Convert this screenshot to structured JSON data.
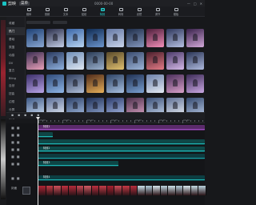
{
  "app": {
    "name": "剪映",
    "menu_label": "菜单",
    "title": "0000-00-00",
    "window_controls": [
      "—",
      "□",
      "✕"
    ]
  },
  "toolbar": {
    "items": [
      {
        "label": "媒体",
        "icon": "media-icon"
      },
      {
        "label": "音频",
        "icon": "audio-icon"
      },
      {
        "label": "文本",
        "icon": "text-icon"
      },
      {
        "label": "贴纸",
        "icon": "sticker-icon"
      },
      {
        "label": "特效",
        "icon": "effects-icon",
        "active": true
      },
      {
        "label": "转场",
        "icon": "transition-icon"
      },
      {
        "label": "滤镜",
        "icon": "filter-icon"
      },
      {
        "label": "调节",
        "icon": "adjust-icon"
      },
      {
        "label": "模板",
        "icon": "template-icon"
      }
    ]
  },
  "categories": {
    "items": [
      "收藏",
      "热门",
      "基础",
      "氛围",
      "动感",
      "DV",
      "复古",
      "Bling",
      "自然",
      "扭曲",
      "边框",
      "分屏",
      "纹理",
      "漫画",
      "金粉",
      "光"
    ],
    "active_index": 1
  },
  "thumbs": {
    "colors": [
      [
        "#1c3f73",
        "#8aa7d2"
      ],
      [
        "#2a2e4a",
        "#c3cde6"
      ],
      [
        "#3a66a8",
        "#b8d4f1"
      ],
      [
        "#0f2b53",
        "#6c95cc"
      ],
      [
        "#6478a4",
        "#c9d4ea"
      ],
      [
        "#1e2d49",
        "#8497bd"
      ],
      [
        "#4c1d3a",
        "#f28fb8"
      ],
      [
        "#2e375c",
        "#b5c0e2"
      ],
      [
        "#38214a",
        "#d2a8d9"
      ],
      [
        "#3b2e52",
        "#e8a0b8"
      ],
      [
        "#2a3a5f",
        "#8fb1de"
      ],
      [
        "#6f8fb8",
        "#e0e8f2"
      ],
      [
        "#2a3b55",
        "#9ab0cc"
      ],
      [
        "#5a4a2a",
        "#e0c070"
      ],
      [
        "#3a4b6f",
        "#9cb4d7"
      ],
      [
        "#4a1f2c",
        "#e27b86"
      ],
      [
        "#4c3b6a",
        "#d3b8e6"
      ],
      [
        "#2a3556",
        "#aeb9dd"
      ],
      [
        "#3a2e68",
        "#b8a4e6"
      ],
      [
        "#2f4a78",
        "#8fb6e6"
      ],
      [
        "#2e3c5c",
        "#b0bfd9"
      ],
      [
        "#4e2a1a",
        "#e6b05a"
      ],
      [
        "#2c4264",
        "#a8c0e0"
      ],
      [
        "#1f3052",
        "#7aa0d0"
      ],
      [
        "#6a7fa8",
        "#e4eaf3"
      ],
      [
        "#4a2e5a",
        "#d8a0c8"
      ],
      [
        "#3b2a55",
        "#c9a7e2"
      ],
      [
        "#3c5784",
        "#c7d8ef"
      ],
      [
        "#5a6d96",
        "#dfe6f2"
      ],
      [
        "#2b3f66",
        "#9fb7dc"
      ],
      [
        "#1e2f55",
        "#8fa4cf"
      ],
      [
        "#2a3a6a",
        "#a6b8e2"
      ],
      [
        "#4a2f4a",
        "#d69fc0"
      ],
      [
        "#3a4f76",
        "#bfcfe7"
      ],
      [
        "#5e6f94",
        "#e3e8f1"
      ],
      [
        "#33486e",
        "#b2c3e0"
      ]
    ]
  },
  "player": {
    "icons": [
      "undo-icon",
      "redo-icon",
      "split-icon",
      "delete-icon",
      "crop-icon"
    ]
  },
  "ruler": {
    "labels": [
      "00:00",
      "00:05",
      "00:10",
      "00:15",
      "00:20",
      "00:25",
      "00:30"
    ]
  },
  "timeline": {
    "tracks": [
      {
        "label": "特效1",
        "color": "#5a2a6a",
        "line": "#9b4cc0"
      },
      {
        "label": "",
        "color": "#0f4444",
        "line": "#1fb5b5"
      },
      {
        "label": "",
        "color": "#0f4747",
        "line": "#1fb5b5"
      },
      {
        "label": "特效2",
        "color": "#0e4a4a",
        "line": "#23c2c2"
      },
      {
        "label": "",
        "color": "#0d3b3f",
        "line": "#1b9fa5"
      },
      {
        "label": "特效3",
        "color": "#0d4646",
        "line": "#1fb5b5"
      },
      {
        "label": "特效4",
        "color": "#0c3e42",
        "line": "#1fb5b5"
      }
    ],
    "video_label": "封面",
    "frame_colors": [
      "#b02434",
      "#c53a45",
      "#d24f5a",
      "#c23040",
      "#b52a3a",
      "#c94955",
      "#d45a63",
      "#bd2f3f",
      "#c43c48",
      "#a8202f",
      "#cf4b56",
      "#c73845",
      "#b82d3c",
      "#c9e1ea",
      "#aecbd8",
      "#d6e6ec",
      "#bcd4df",
      "#cde2ea",
      "#b3ccd8",
      "#d8e8ee",
      "#c4dbe4",
      "#b9d1dc"
    ]
  }
}
